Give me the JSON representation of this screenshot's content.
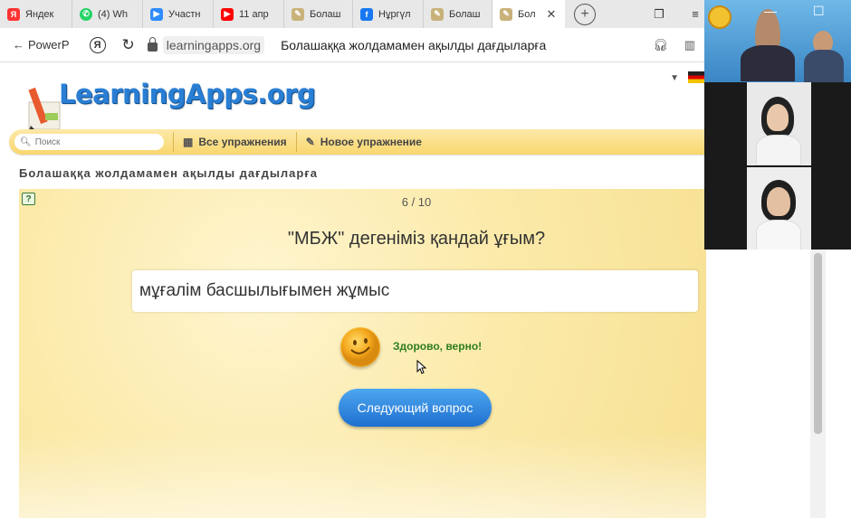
{
  "browser": {
    "tabs": [
      {
        "label": "Яндек",
        "icon": "yandex-icon",
        "color": "#ff3333"
      },
      {
        "label": "(4) Wh",
        "icon": "whatsapp-icon",
        "color": "#25d366"
      },
      {
        "label": "Участн",
        "icon": "zoom-icon",
        "color": "#2d8cff"
      },
      {
        "label": "11 апр",
        "icon": "youtube-icon",
        "color": "#ff0000"
      },
      {
        "label": "Болаш",
        "icon": "learningapps-icon",
        "color": "#c9b27a"
      },
      {
        "label": "Нұргүл",
        "icon": "facebook-icon",
        "color": "#1877f2"
      },
      {
        "label": "Болаш",
        "icon": "learningapps-icon",
        "color": "#c9b27a"
      },
      {
        "label": "Бол",
        "icon": "learningapps-icon",
        "color": "#c9b27a"
      }
    ],
    "new_tab": "+",
    "back_label": "PowerP",
    "url": "learningapps.org",
    "page_title": "Болашаққа жолдамамен ақылды дағдыларға"
  },
  "site": {
    "logo_text": "LearningApps.org",
    "search_placeholder": "Поиск",
    "nav_all": "Все упражнения",
    "nav_new": "Новое упражнение",
    "app_title": "Болашаққа жолдамамен ақылды дағдыларға"
  },
  "quiz": {
    "progress": "6 / 10",
    "question": "\"МБЖ\" дегеніміз қандай ұғым?",
    "answer": "мұғалім басшылығымен жұмыс",
    "feedback": "Здорово, верно!",
    "next_button": "Следующий вопрос"
  },
  "colors": {
    "accent": "#2a7fd4",
    "feedback": "#2e7d1e",
    "button": "#1f6fd0"
  }
}
